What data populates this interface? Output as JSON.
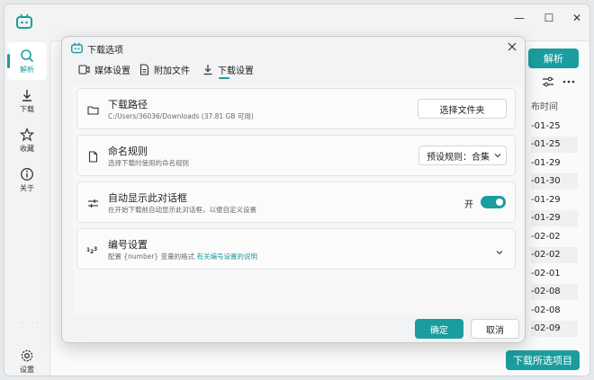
{
  "colors": {
    "accent": "#1b9d9f"
  },
  "window": {
    "controls": {
      "minimize": "—",
      "maximize": "☐",
      "close": "✕"
    }
  },
  "sidebar": {
    "items": [
      {
        "label": "解析",
        "icon": "search-icon"
      },
      {
        "label": "下载",
        "icon": "download-icon"
      },
      {
        "label": "收藏",
        "icon": "star-icon"
      },
      {
        "label": "关于",
        "icon": "info-icon"
      },
      {
        "label": "设置",
        "icon": "gear-icon"
      }
    ]
  },
  "main": {
    "parse_button": "解析",
    "column_header": "布时间",
    "dates": [
      "-01-25",
      "-01-25",
      "-01-29",
      "-01-30",
      "-01-29",
      "-01-29",
      "-02-02",
      "-02-02",
      "-02-01",
      "-02-08",
      "-02-08",
      "-02-09"
    ],
    "download_selected_button": "下载所选项目"
  },
  "dialog": {
    "title": "下载选项",
    "tabs": [
      {
        "label": "媒体设置",
        "icon": "media-icon"
      },
      {
        "label": "附加文件",
        "icon": "file-icon"
      },
      {
        "label": "下载设置",
        "icon": "download-icon"
      }
    ],
    "active_tab": "下载设置",
    "cards": {
      "path": {
        "title": "下载路径",
        "subtitle": "C:/Users/36036/Downloads (37.81 GB 可用)",
        "button": "选择文件夹"
      },
      "naming": {
        "title": "命名规则",
        "subtitle": "选择下载时使用的命名规则",
        "select_value": "预设规则：合集"
      },
      "auto_dialog": {
        "title": "自动显示此对话框",
        "subtitle": "在开始下载前自动显示此对话框，以便自定义设置",
        "toggle_label": "开",
        "toggle_on": true
      },
      "numbering": {
        "title": "编号设置",
        "subtitle": "配置 {number} 变量的格式",
        "link": "有关编号设置的说明"
      }
    },
    "ok_button": "确定",
    "cancel_button": "取消"
  }
}
